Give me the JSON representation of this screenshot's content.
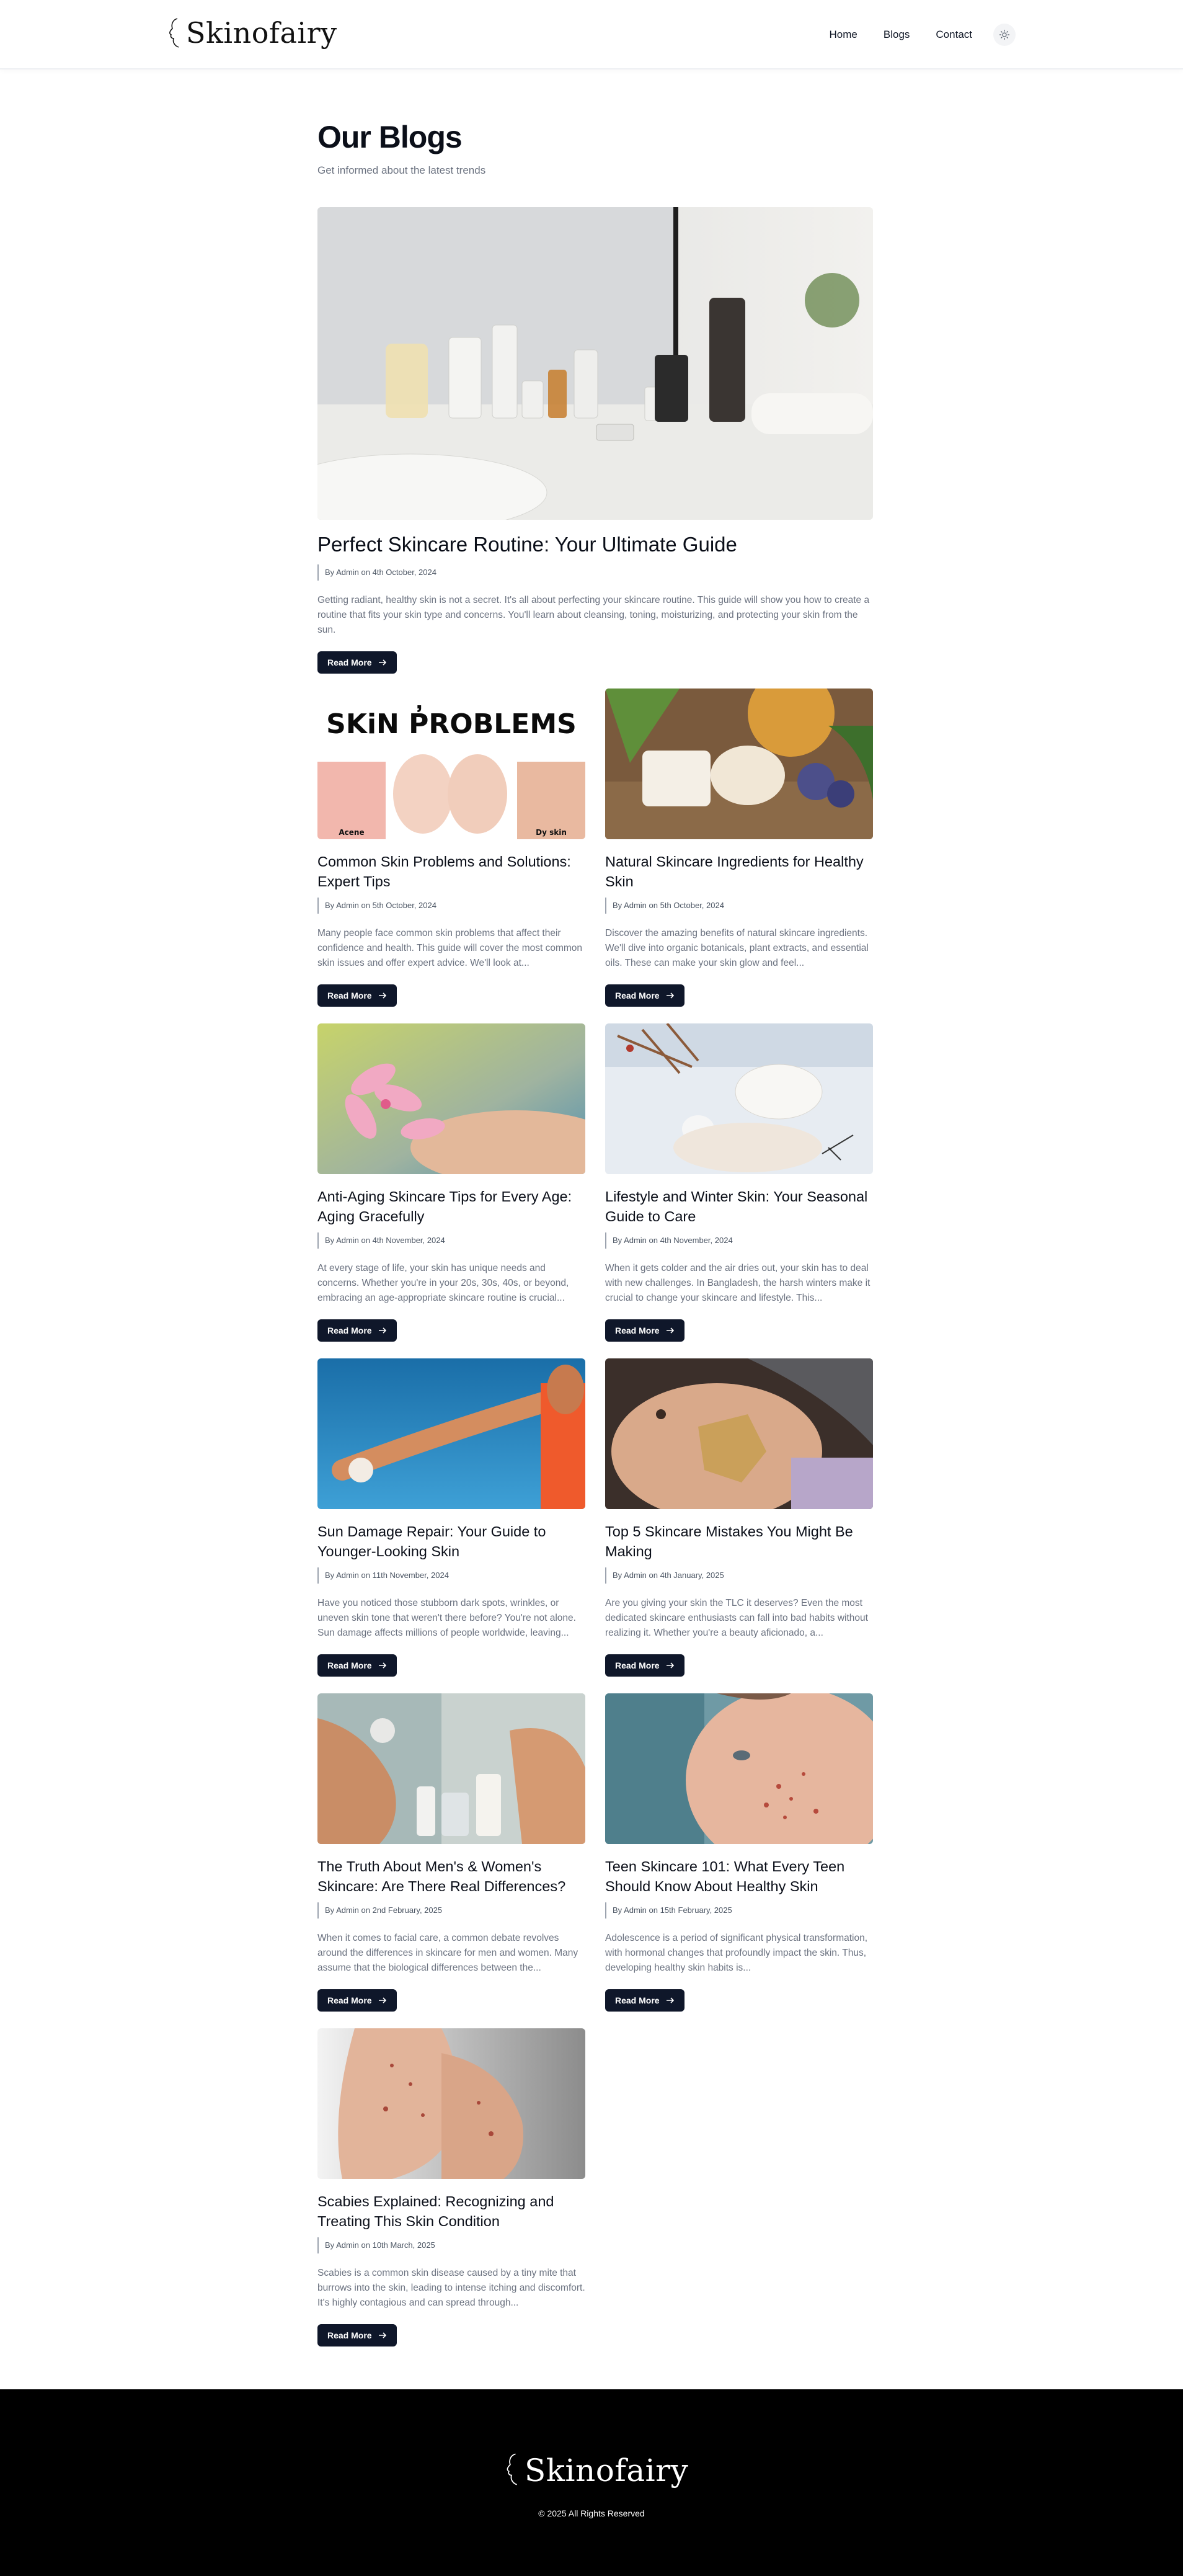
{
  "header": {
    "brand": "Skinofairy",
    "nav": [
      "Home",
      "Blogs",
      "Contact"
    ],
    "theme_icon": "sun-icon"
  },
  "page": {
    "title": "Our Blogs",
    "subtitle": "Get informed about the latest trends"
  },
  "featured": {
    "title": "Perfect Skincare Routine: Your Ultimate Guide",
    "meta": "By Admin on 4th October, 2024",
    "excerpt": "Getting radiant, healthy skin is not a secret. It's all about perfecting your skincare routine. This guide will show you how to create a routine that fits your skin type and concerns. You'll learn about cleansing, toning, moisturizing, and protecting your skin from the sun.",
    "cta": "Read More"
  },
  "posts": [
    {
      "title": "Common Skin Problems and Solutions: Expert Tips",
      "meta": "By Admin on 5th October, 2024",
      "excerpt": "Many people face common skin problems that affect their confidence and health. This guide will cover the most common skin issues and offer expert advice. We'll look at...",
      "cta": "Read More",
      "image_text": {
        "heading": "SKiN P̓ROBLEMS",
        "left": "Acene",
        "right": "Dy skin"
      }
    },
    {
      "title": "Natural Skincare Ingredients for Healthy Skin",
      "meta": "By Admin on 5th October, 2024",
      "excerpt": "Discover the amazing benefits of natural skincare ingredients. We'll dive into organic botanicals, plant extracts, and essential oils. These can make your skin glow and feel...",
      "cta": "Read More"
    },
    {
      "title": "Anti-Aging Skincare Tips for Every Age: Aging Gracefully",
      "meta": "By Admin on 4th November, 2024",
      "excerpt": "At every stage of life, your skin has unique needs and concerns. Whether you're in your 20s, 30s, 40s, or beyond, embracing an age-appropriate skincare routine is crucial...",
      "cta": "Read More"
    },
    {
      "title": "Lifestyle and Winter Skin: Your Seasonal Guide to Care",
      "meta": "By Admin on 4th November, 2024",
      "excerpt": "When it gets colder and the air dries out, your skin has to deal with new challenges. In Bangladesh, the harsh winters make it crucial to change your skincare and lifestyle. This...",
      "cta": "Read More"
    },
    {
      "title": "Sun Damage Repair: Your Guide to Younger-Looking Skin",
      "meta": "By Admin on 11th November, 2024",
      "excerpt": "Have you noticed those stubborn dark spots, wrinkles, or uneven skin tone that weren't there before? You're not alone. Sun damage affects millions of people worldwide, leaving...",
      "cta": "Read More"
    },
    {
      "title": "Top 5 Skincare Mistakes You Might Be Making",
      "meta": "By Admin on 4th January, 2025",
      "excerpt": "Are you giving your skin the TLC it deserves? Even the most dedicated skincare enthusiasts can fall into bad habits without realizing it. Whether you're a beauty aficionado, a...",
      "cta": "Read More"
    },
    {
      "title": "The Truth About Men's & Women's Skincare: Are There Real Differences?",
      "meta": "By Admin on 2nd February, 2025",
      "excerpt": "When it comes to facial care, a common debate revolves around the differences in skincare for men and women. Many assume that the biological differences between the...",
      "cta": "Read More"
    },
    {
      "title": "Teen Skincare 101: What Every Teen Should Know About Healthy Skin",
      "meta": "By Admin on 15th February, 2025",
      "excerpt": "Adolescence is a period of significant physical transformation, with hormonal changes that profoundly impact the skin. Thus, developing healthy skin habits is...",
      "cta": "Read More"
    },
    {
      "title": "Scabies Explained: Recognizing and Treating This Skin Condition",
      "meta": "By Admin on 10th March, 2025",
      "excerpt": "Scabies is a common skin disease caused by a tiny mite that burrows into the skin, leading to intense itching and discomfort. It's highly contagious and can spread through...",
      "cta": "Read More"
    }
  ],
  "footer": {
    "brand": "Skinofairy",
    "copyright": "© 2025 All Rights Reserved"
  }
}
